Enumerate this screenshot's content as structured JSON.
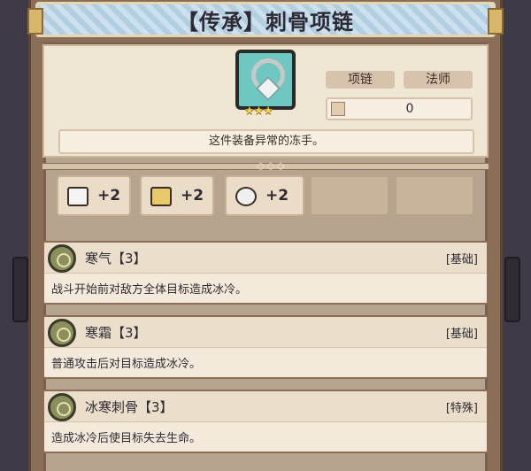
{
  "title": "【传承】刺骨项链",
  "item": {
    "icon": "necklace-icon",
    "stars": "★★★",
    "tags": [
      "项链",
      "法师"
    ],
    "stat_icon": "slot-icon",
    "stat_value": "0",
    "description": "这件装备异常的冻手。"
  },
  "gear_slots": [
    {
      "icon": "book-icon",
      "value": "+2"
    },
    {
      "icon": "scroll-icon",
      "value": "+2"
    },
    {
      "icon": "rock-icon",
      "value": "+2"
    }
  ],
  "skills": [
    {
      "name": "寒气【3】",
      "type": "[基础]",
      "desc": "战斗开始前对敌方全体目标造成冰冷。"
    },
    {
      "name": "寒霜【3】",
      "type": "[基础]",
      "desc": "普通攻击后对目标造成冰冷。"
    },
    {
      "name": "冰寒刺骨【3】",
      "type": "[特殊]",
      "desc": "造成冰冷后使目标失去生命。"
    }
  ]
}
